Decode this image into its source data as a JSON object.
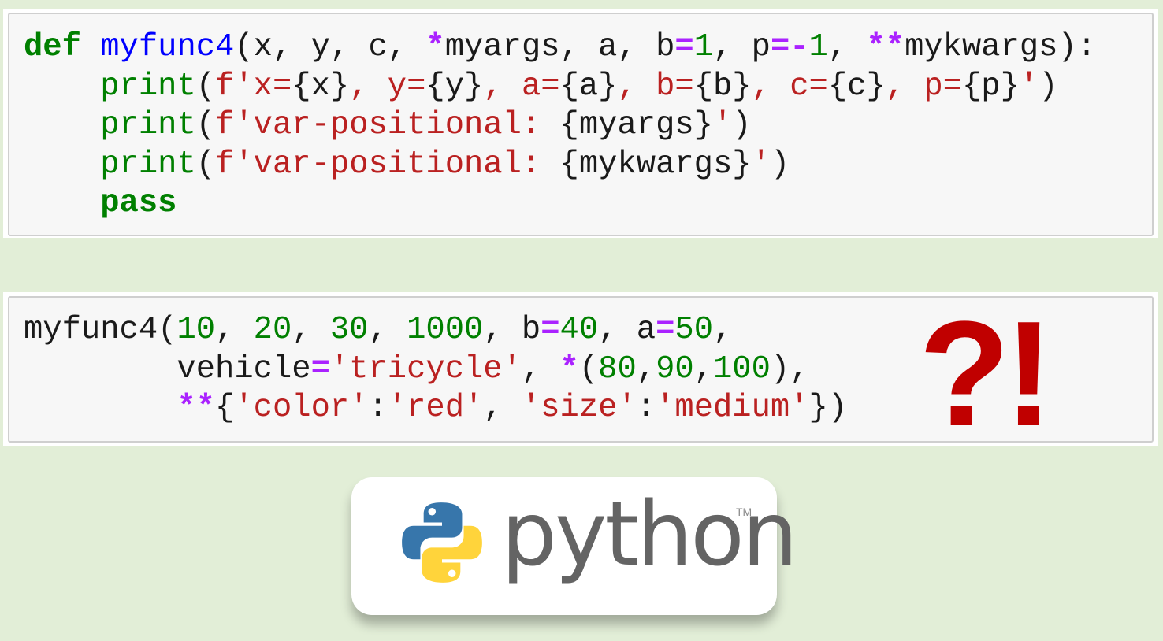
{
  "snippet_definition": {
    "lines": [
      [
        {
          "t": "def",
          "c": "kw"
        },
        {
          "t": " "
        },
        {
          "t": "myfunc4",
          "c": "fn"
        },
        {
          "t": "(x, y, c, "
        },
        {
          "t": "*",
          "c": "op"
        },
        {
          "t": "myargs, a, b"
        },
        {
          "t": "=",
          "c": "op"
        },
        {
          "t": "1",
          "c": "num"
        },
        {
          "t": ", p"
        },
        {
          "t": "=-",
          "c": "op"
        },
        {
          "t": "1",
          "c": "num"
        },
        {
          "t": ", "
        },
        {
          "t": "**",
          "c": "op"
        },
        {
          "t": "mykwargs):"
        }
      ],
      [
        {
          "t": "    "
        },
        {
          "t": "print",
          "c": "bi"
        },
        {
          "t": "("
        },
        {
          "t": "f'x=",
          "c": "str"
        },
        {
          "t": "{x}"
        },
        {
          "t": ", y=",
          "c": "str"
        },
        {
          "t": "{y}"
        },
        {
          "t": ", a=",
          "c": "str"
        },
        {
          "t": "{a}"
        },
        {
          "t": ", b=",
          "c": "str"
        },
        {
          "t": "{b}"
        },
        {
          "t": ", c=",
          "c": "str"
        },
        {
          "t": "{c}"
        },
        {
          "t": ", p=",
          "c": "str"
        },
        {
          "t": "{p}"
        },
        {
          "t": "'",
          "c": "str"
        },
        {
          "t": ")"
        }
      ],
      [
        {
          "t": "    "
        },
        {
          "t": "print",
          "c": "bi"
        },
        {
          "t": "("
        },
        {
          "t": "f'var-positional: ",
          "c": "str"
        },
        {
          "t": "{myargs}"
        },
        {
          "t": "'",
          "c": "str"
        },
        {
          "t": ")"
        }
      ],
      [
        {
          "t": "    "
        },
        {
          "t": "print",
          "c": "bi"
        },
        {
          "t": "("
        },
        {
          "t": "f'var-positional: ",
          "c": "str"
        },
        {
          "t": "{mykwargs}"
        },
        {
          "t": "'",
          "c": "str"
        },
        {
          "t": ")"
        }
      ],
      [
        {
          "t": "    "
        },
        {
          "t": "pass",
          "c": "kw"
        }
      ]
    ]
  },
  "snippet_call": {
    "lines": [
      [
        {
          "t": "myfunc4("
        },
        {
          "t": "10",
          "c": "num"
        },
        {
          "t": ", "
        },
        {
          "t": "20",
          "c": "num"
        },
        {
          "t": ", "
        },
        {
          "t": "30",
          "c": "num"
        },
        {
          "t": ", "
        },
        {
          "t": "1000",
          "c": "num"
        },
        {
          "t": ", b"
        },
        {
          "t": "=",
          "c": "op"
        },
        {
          "t": "40",
          "c": "num"
        },
        {
          "t": ", a"
        },
        {
          "t": "=",
          "c": "op"
        },
        {
          "t": "50",
          "c": "num"
        },
        {
          "t": ","
        }
      ],
      [
        {
          "t": "        vehicle"
        },
        {
          "t": "=",
          "c": "op"
        },
        {
          "t": "'tricycle'",
          "c": "str"
        },
        {
          "t": ", "
        },
        {
          "t": "*",
          "c": "op"
        },
        {
          "t": "("
        },
        {
          "t": "80",
          "c": "num"
        },
        {
          "t": ","
        },
        {
          "t": "90",
          "c": "num"
        },
        {
          "t": ","
        },
        {
          "t": "100",
          "c": "num"
        },
        {
          "t": "),"
        }
      ],
      [
        {
          "t": "        "
        },
        {
          "t": "**",
          "c": "op"
        },
        {
          "t": "{"
        },
        {
          "t": "'color'",
          "c": "str"
        },
        {
          "t": ":"
        },
        {
          "t": "'red'",
          "c": "str"
        },
        {
          "t": ", "
        },
        {
          "t": "'size'",
          "c": "str"
        },
        {
          "t": ":"
        },
        {
          "t": "'medium'",
          "c": "str"
        },
        {
          "t": "})"
        }
      ]
    ]
  },
  "annotation": {
    "text": "?!",
    "color": "#c00000"
  },
  "logo": {
    "wordmark": "python",
    "trademark": "TM",
    "colors": {
      "blue": "#3776ab",
      "yellow": "#ffd43b",
      "text": "#646464"
    }
  },
  "theme": {
    "background": "#e2eed7",
    "cell_background": "#f7f7f7",
    "keyword": "#008000",
    "function_name": "#0000ff",
    "string": "#ba2121",
    "number": "#008000",
    "operator": "#aa22ff"
  }
}
